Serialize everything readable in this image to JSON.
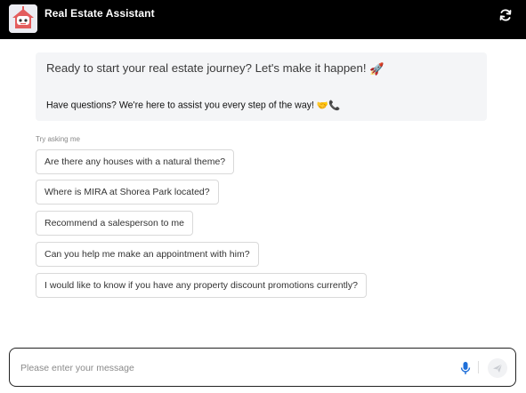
{
  "header": {
    "title": "Real Estate Assistant",
    "avatar_icon": "robot-house-icon",
    "refresh_icon": "refresh-icon"
  },
  "welcome": {
    "title": "Ready to start your real estate journey? Let's make it happen!",
    "title_emoji": "🚀",
    "subtitle": "Have questions? We're here to assist you every step of the way!",
    "subtitle_emoji": "🤝📞"
  },
  "suggestions": {
    "label": "Try asking me",
    "items": [
      "Are there any houses with a natural theme?",
      "Where is MIRA at Shorea Park located?",
      "Recommend a salesperson to me",
      "Can you help me make an appointment with him?",
      "I would like to know if you have any property discount promotions currently?"
    ]
  },
  "input": {
    "placeholder": "Please enter your message",
    "mic_icon": "microphone-icon",
    "send_icon": "send-icon"
  },
  "colors": {
    "header_bg": "#000000",
    "welcome_bg": "#f4f5f7",
    "mic": "#1e6fd9"
  }
}
